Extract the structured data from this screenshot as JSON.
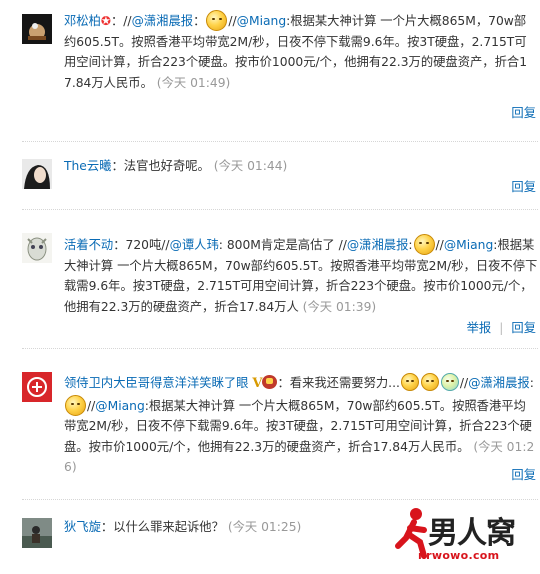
{
  "comments": [
    {
      "user": "邓松柏",
      "text_before": "：//",
      "mention1": "@潇湘晨报",
      "mid": "：",
      "mid2": "//",
      "mention2": "@Miang",
      "text": ":根据某大神计算 一个片大概865M，70w部约605.5T。按照香港平均带宽2M/秒，日夜不停下载需9.6年。按3T硬盘，2.715T可用空间计算，折合223个硬盘。按市价1000元/个，他拥有22.3万的硬盘资产，折合17.84万人民币。",
      "time": "(今天 01:49)",
      "reply": "回复"
    },
    {
      "user": "The云曦",
      "text": "：法官也好奇呢。",
      "time": "(今天 01:44)",
      "reply": "回复"
    },
    {
      "user": "活着不动",
      "text_before": "：720吨//",
      "mention1": "@谭人玮",
      "text_mid": ": 800M肯定是高估了 //",
      "mention2": "@潇湘晨报",
      "mid": ":",
      "mid2": "//",
      "mention3": "@Miang",
      "text": ":根据某大神计算 一个片大概865M，70w部约605.5T。按照香港平均带宽2M/秒，日夜不停下载需9.6年。按3T硬盘，2.715T可用空间计算，折合223个硬盘。按市价1000元/个，他拥有22.3万的硬盘资产，折合17.84万人",
      "time": "(今天 01:39)",
      "report": "举报",
      "reply": "回复"
    },
    {
      "user": "领侍卫内大臣哥得意洋洋笑眯了眼",
      "verified": "V",
      "text_before": "：看来我还需要努力...",
      "mid0": "//",
      "mention1": "@潇湘晨报",
      "mid": ":",
      "mid2": "//",
      "mention2": "@Miang",
      "text": ":根据某大神计算 一个片大概865M，70w部约605.5T。按照香港平均带宽2M/秒，日夜不停下载需9.6年。按3T硬盘，2.715T可用空间计算，折合223个硬盘。按市价1000元/个，他拥有22.3万的硬盘资产，折合17.84万人民币。",
      "time": "(今天 01:26)",
      "reply": "回复"
    },
    {
      "user": "狄飞旋",
      "text": "：以什么罪来起诉他？",
      "time": "(今天 01:25)"
    }
  ],
  "watermark": {
    "brand": "男人窝",
    "url": "nrwowo.com"
  },
  "colors": {
    "link": "#0a6bb5",
    "time": "#999999",
    "watermark_red": "#d8141c"
  }
}
